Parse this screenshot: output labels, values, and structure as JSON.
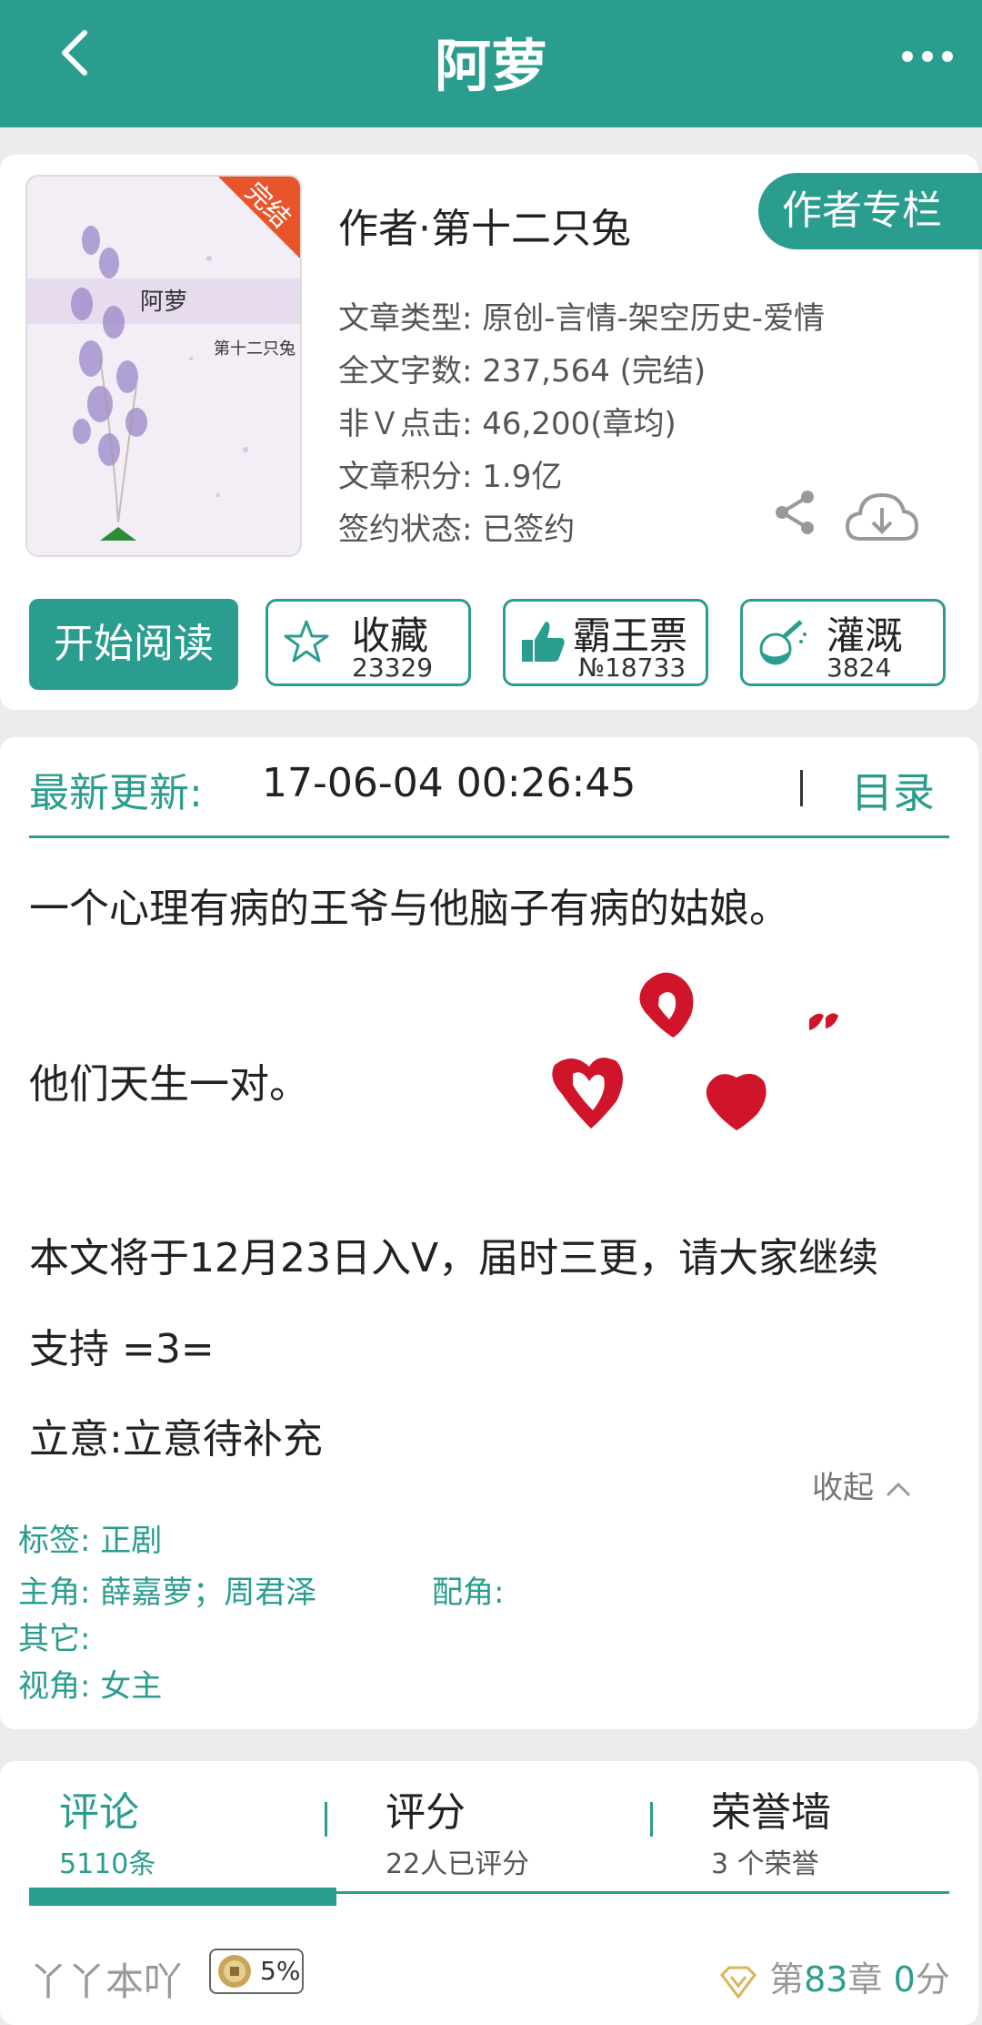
{
  "header": {
    "title": "阿萝",
    "back_icon": "chevron-left-icon",
    "more_icon": "more-dots-icon"
  },
  "book": {
    "cover_title": "阿萝",
    "cover_author": "第十二只兔",
    "cover_badge": "完结",
    "author_line": "作者·第十二只兔",
    "author_column_label": "作者专栏",
    "info": [
      {
        "key": "文章类型: ",
        "value": "原创-言情-架空历史-爱情"
      },
      {
        "key": "全文字数: ",
        "value": "237,564 (完结)"
      },
      {
        "key": "非Ｖ点击: ",
        "value": "46,200(章均)"
      },
      {
        "key": "文章积分: ",
        "value": "1.9亿"
      },
      {
        "key": "签约状态: ",
        "value": "已签约"
      }
    ],
    "share_icon": "share-icon",
    "download_icon": "cloud-download-icon"
  },
  "actions": {
    "read_label": "开始阅读",
    "favorite": {
      "label": "收藏",
      "count": "23329",
      "icon": "star-icon"
    },
    "overlord": {
      "label": "霸王票",
      "count": "№18733",
      "icon": "thumbs-up-icon"
    },
    "nutrient": {
      "label": "灌溉",
      "count": "3824",
      "icon": "nutrient-bottle-icon"
    }
  },
  "update": {
    "label": "最新更新:",
    "time": "17-06-04 00:26:45",
    "toc_label": "目录"
  },
  "description": {
    "lines": [
      "一个心理有病的王爷与他脑子有病的姑娘。",
      "他们天生一对。",
      "本文将于12月23日入V，届时三更，请大家继续",
      "支持 =3=",
      "立意:立意待补充"
    ],
    "collapse_label": "收起"
  },
  "tags": {
    "tag_key": "标签:",
    "tag_value": "正剧",
    "lead_key": "主角:",
    "lead_value": "薛嘉萝；周君泽",
    "support_key": "配角:",
    "other_key": "其它:",
    "view_key": "视角:",
    "view_value": "女主"
  },
  "tabs": [
    {
      "title": "评论",
      "sub": "5110条"
    },
    {
      "title": "评分",
      "sub": "22人已评分"
    },
    {
      "title": "荣誉墙",
      "sub": "3 个荣誉"
    }
  ],
  "comment": {
    "user": "丫丫本吖",
    "badge": "5%",
    "chapter_prefix": "第",
    "chapter_num": "83",
    "chapter_suffix": "章",
    "score_num": "0",
    "score_suffix": "分"
  },
  "colors": {
    "accent": "#2a9d8f",
    "heart": "#d0142a"
  }
}
